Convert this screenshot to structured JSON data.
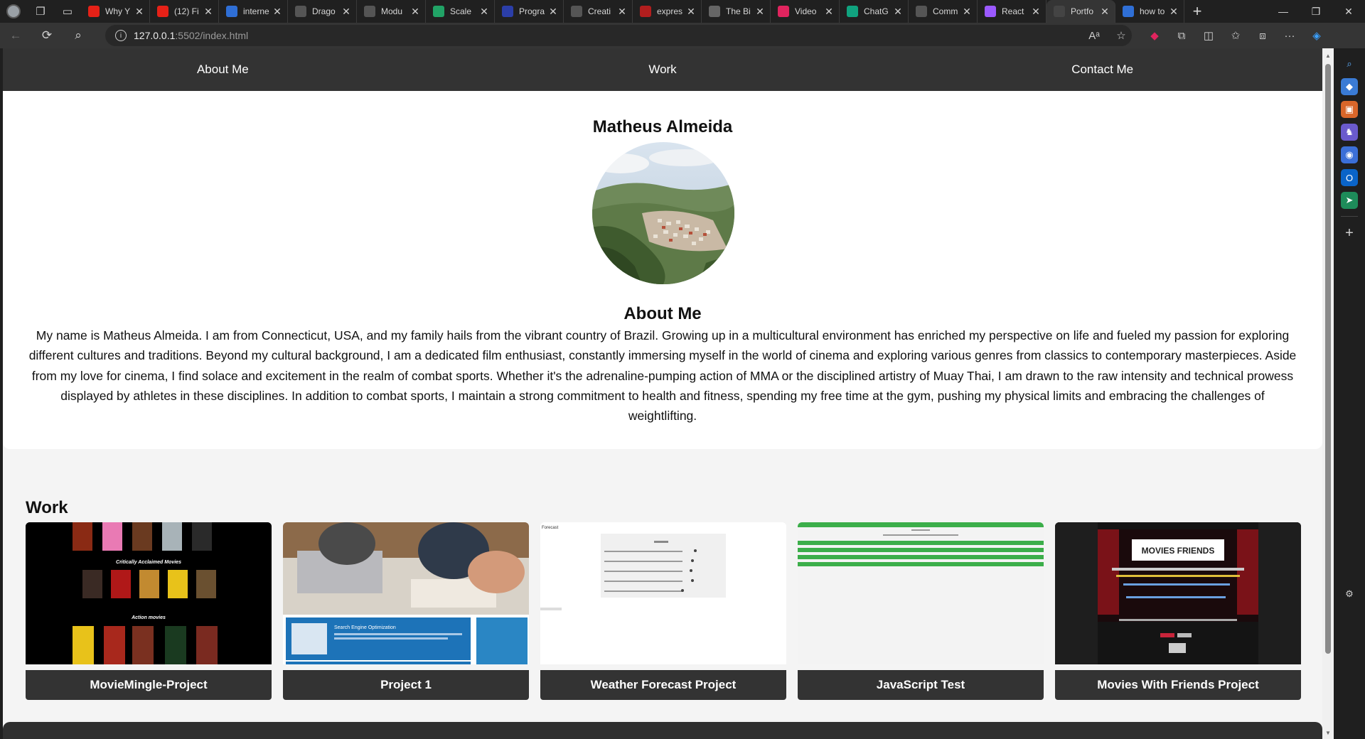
{
  "browser": {
    "tabs": [
      {
        "title": "Why Y",
        "favicon": "youtube-icon",
        "color": "#e62117"
      },
      {
        "title": "(12) Fi",
        "favicon": "youtube-icon",
        "color": "#e62117"
      },
      {
        "title": "interne",
        "favicon": "search-icon",
        "color": "#2f6fd6"
      },
      {
        "title": "Drago",
        "favicon": "document-icon",
        "color": "#555555"
      },
      {
        "title": "Modu",
        "favicon": "module-icon",
        "color": "#555555"
      },
      {
        "title": "Scale",
        "favicon": "scale-icon",
        "color": "#21a366"
      },
      {
        "title": "Progra",
        "favicon": "zm-icon",
        "color": "#2b3ea8"
      },
      {
        "title": "Creati",
        "favicon": "github-icon",
        "color": "#555555"
      },
      {
        "title": "expres",
        "favicon": "express-icon",
        "color": "#b21e1e"
      },
      {
        "title": "The Bi",
        "favicon": "image-icon",
        "color": "#666666"
      },
      {
        "title": "Video",
        "favicon": "video-icon",
        "color": "#e0245e"
      },
      {
        "title": "ChatG",
        "favicon": "chatgpt-icon",
        "color": "#10a37f"
      },
      {
        "title": "Comm",
        "favicon": "github-icon",
        "color": "#555555"
      },
      {
        "title": "React",
        "favicon": "vite-icon",
        "color": "#9b59ff"
      },
      {
        "title": "Portfo",
        "favicon": "page-icon",
        "color": "#444444",
        "active": true
      },
      {
        "title": "how to",
        "favicon": "search-icon",
        "color": "#2f6fd6"
      }
    ],
    "url_host": "127.0.0.1",
    "url_path": ":5502/index.html"
  },
  "nav": {
    "about": "About Me",
    "work": "Work",
    "contact": "Contact Me"
  },
  "profile": {
    "name": "Matheus Almeida",
    "about_heading": "About Me",
    "bio": "My name is Matheus Almeida. I am from Connecticut, USA, and my family hails from the vibrant country of Brazil. Growing up in a multicultural environment has enriched my perspective on life and fueled my passion for exploring different cultures and traditions. Beyond my cultural background, I am a dedicated film enthusiast, constantly immersing myself in the world of cinema and exploring various genres from classics to contemporary masterpieces. Aside from my love for cinema, I find solace and excitement in the realm of combat sports. Whether it's the adrenaline-pumping action of MMA or the disciplined artistry of Muay Thai, I am drawn to the raw intensity and technical prowess displayed by athletes in these disciplines. In addition to combat sports, I maintain a strong commitment to health and fitness, spending my free time at the gym, pushing my physical limits and embracing the challenges of weightlifting."
  },
  "work": {
    "heading": "Work",
    "projects": [
      {
        "title": "MovieMingle-Project",
        "thumb_heading": "Critically Acclaimed Movies",
        "thumb_subheading": "Action movies"
      },
      {
        "title": "Project 1",
        "thumb_heading": "Search Engine Optimization"
      },
      {
        "title": "Weather Forecast Project",
        "thumb_heading": "Forecast"
      },
      {
        "title": "JavaScript Test"
      },
      {
        "title": "Movies With Friends Project",
        "thumb_heading": "MOVIES FRIENDS"
      }
    ]
  }
}
